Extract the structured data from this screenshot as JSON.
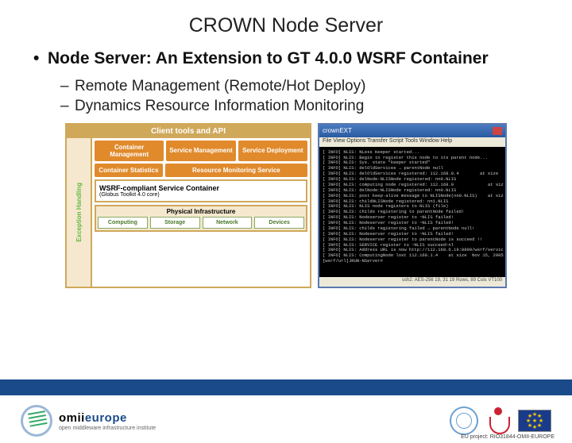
{
  "title": "CROWN Node Server",
  "main_bullet": "Node Server: An Extension to GT 4.0.0 WSRF Container",
  "sub_bullets": [
    "Remote Management (Remote/Hot Deploy)",
    "Dynamics Resource Information Monitoring"
  ],
  "arch": {
    "header": "Client tools and API",
    "side": "Exception Handling",
    "row1": [
      "Container Management",
      "Service Management",
      "Service Deployment"
    ],
    "row2": [
      "Container Statistics",
      "Resource Monitoring Service"
    ],
    "wsrf_title": "WSRF-compliant Service Container",
    "wsrf_sub": "(Globus Toolkit 4.0 core)",
    "phys_title": "Physical Infrastructure",
    "phys_items": [
      "Computing",
      "Storage",
      "Network",
      "Devices"
    ]
  },
  "terminal": {
    "title": "crownEXT",
    "menu": "File  View  Options  Transfer  Script  Tools  Window  Help",
    "lines": [
      "[ INFO] NLIS: NLess Keeper started...",
      "[ INFO] NLIS: Begin to register this node to its parent node...",
      "[ INFO] NLIS: Sys. state \"keeper started\"",
      "[ INFO] NLIS: delOldServices → parentNode null",
      "[ INFO] NLIS: delOldServices registered: 112.168.0.4        at size  Nov 15, 2005 8:22:48",
      "[ INFO] NLIS: delNode:NLISNode registered: nn0.NLIS",
      "[ INFO] NLIS: computing node registered: 112.168.0             at size  Nov 15, 2005 8:22:48",
      "[ INFO] NLIS: delNode:NLISNode registered: nn0.NLIS",
      "[ INFO] NLIS: post keep-alive message to NLISNode(nn0.NLIS)    at size  Nov 1, 2005 6:18:29",
      "[ INFO] NLIS: childNLISNode registered: nn1.NLIS",
      "[ INFO] NLIS: NLIS node registers to NLIS (file)",
      "[ INFO] NLIS: childs registering to parentNode failed!",
      "[ INFO] NLIS: Nodeserver register to ~NLIS failed!",
      "[ INFO] NLIS: Nodeserver register to ~NLIS failed!",
      "[ INFO] NLIS: childs registering failed → parentNode null!",
      "[ INFO] NLIS: Nodeserver register to ~NLIS failed!",
      "[ INFO] NLIS: Nodeserver register to parentNode is succeed !!",
      "[ INFO] NLIS: SERVICE register to ~NLIS succeed!nl",
      "[ INFO] NLIS: Address URL is now http://112.168.6.19:8899/wsrf/services/NLISService",
      "[ INFO] NLIS: ComputingNode lost 112.168.1.4    at size  Nov 15, 2005 9:50:31 PM",
      "[wsrf/url]JRUN-NServer#"
    ],
    "status": "ssh2: AES-256  19, 31  19 Rows, 89 Cols  VT100"
  },
  "footer": {
    "omii_name": "omii",
    "omii_suffix": "europe",
    "omii_tag": "open middleware infrastructure institute",
    "project_ref": "EU project: RIO31844-OMII-EUROPE"
  }
}
